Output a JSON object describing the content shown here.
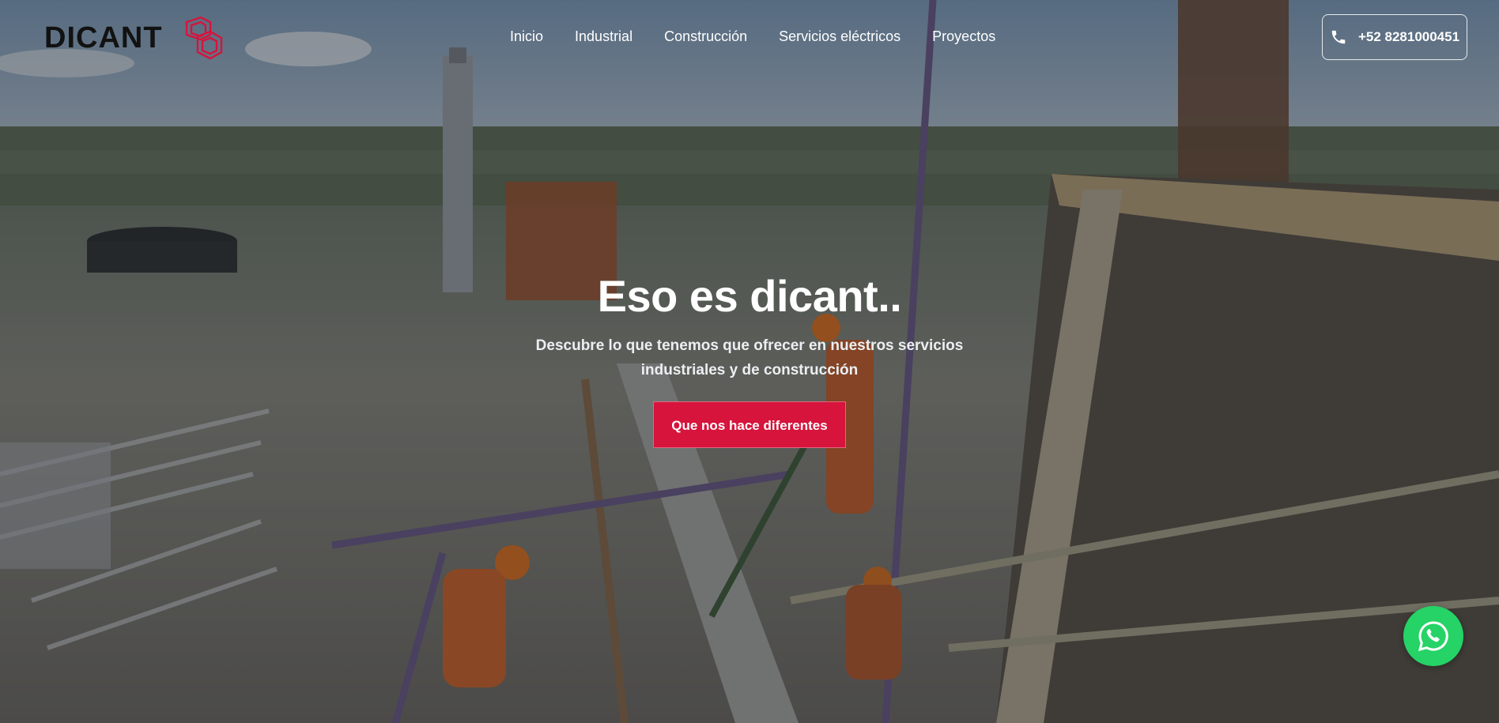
{
  "brand": {
    "name": "DICANT",
    "accent_color": "#d6143c",
    "logo_mark_icon": "dicant-dc-logo-icon"
  },
  "nav": {
    "items": [
      {
        "label": "Inicio"
      },
      {
        "label": "Industrial"
      },
      {
        "label": "Construcción"
      },
      {
        "label": "Servicios eléctricos"
      },
      {
        "label": "Proyectos"
      }
    ]
  },
  "contact": {
    "phone_label": "+52 8281000451",
    "phone_icon": "phone-icon"
  },
  "hero": {
    "title": "Eso es dicant..",
    "subtitle": "Descubre lo que tenemos que ofrecer en nuestros servicios industriales y de construcción",
    "cta_label": "Que nos hace diferentes",
    "background_description_icon": "refinery-scaffolding-photo"
  },
  "floating": {
    "whatsapp_icon": "whatsapp-icon",
    "whatsapp_color": "#25d366"
  }
}
